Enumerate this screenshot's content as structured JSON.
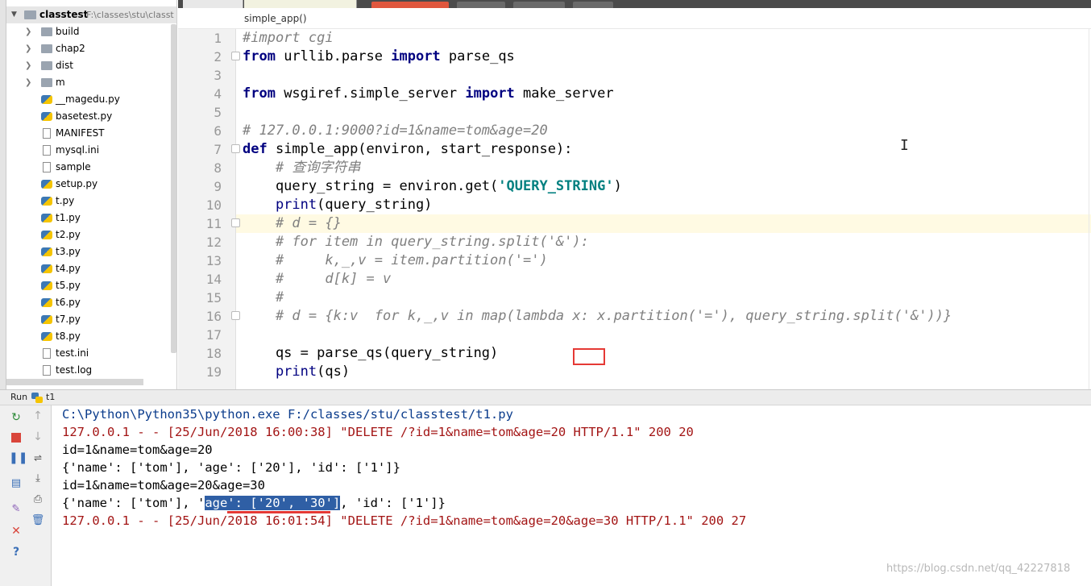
{
  "project": {
    "root_name": "classtest",
    "root_path": "F:\\classes\\stu\\classt",
    "folders": [
      "build",
      "chap2",
      "dist",
      "m"
    ],
    "files": [
      {
        "name": "__magedu.py",
        "type": "py"
      },
      {
        "name": "basetest.py",
        "type": "py"
      },
      {
        "name": "MANIFEST",
        "type": "file"
      },
      {
        "name": "mysql.ini",
        "type": "file"
      },
      {
        "name": "sample",
        "type": "file"
      },
      {
        "name": "setup.py",
        "type": "py"
      },
      {
        "name": "t.py",
        "type": "py"
      },
      {
        "name": "t1.py",
        "type": "py"
      },
      {
        "name": "t2.py",
        "type": "py"
      },
      {
        "name": "t3.py",
        "type": "py"
      },
      {
        "name": "t4.py",
        "type": "py"
      },
      {
        "name": "t5.py",
        "type": "py"
      },
      {
        "name": "t6.py",
        "type": "py"
      },
      {
        "name": "t7.py",
        "type": "py"
      },
      {
        "name": "t8.py",
        "type": "py"
      },
      {
        "name": "test.ini",
        "type": "file"
      },
      {
        "name": "test.log",
        "type": "file"
      }
    ]
  },
  "breadcrumb": "simple_app()",
  "editor": {
    "line_numbers": [
      "1",
      "2",
      "3",
      "4",
      "5",
      "6",
      "7",
      "8",
      "9",
      "10",
      "11",
      "12",
      "13",
      "14",
      "15",
      "16",
      "17",
      "18",
      "19"
    ],
    "current_line": "11",
    "code": {
      "l1": "#import cgi",
      "l2_kw": "from",
      "l2_mod": " urllib.parse ",
      "l2_kw2": "import",
      "l2_name": " parse_qs",
      "l4_kw": "from",
      "l4_mod": " wsgiref.simple_server ",
      "l4_kw2": "import",
      "l4_name": " make_server",
      "l6": "# 127.0.0.1:9000?id=1&name=tom&age=20",
      "l7_kw": "def",
      "l7_rest": " simple_app(environ, start_response):",
      "l8": "    # 查询字符串",
      "l9_a": "    query_string = environ.get(",
      "l9_str": "'QUERY_STRING'",
      "l9_b": ")",
      "l10_fn": "    print",
      "l10_rest": "(query_string)",
      "l11": "    # d = {}",
      "l12": "    # for item in query_string.split('&'):",
      "l13": "    #     k,_,v = item.partition('=')",
      "l14": "    #     d[k] = v",
      "l15": "    #",
      "l16": "    # d = {k:v  for k,_,v in map(lambda x: x.partition('='), query_string.split('&'))}",
      "l18": "    qs = parse_qs(query_string)",
      "l19_fn": "    print",
      "l19_rest": "(qs)"
    }
  },
  "run": {
    "label": "Run",
    "config": "t1",
    "lines": {
      "cmd": "C:\\Python\\Python35\\python.exe F:/classes/stu/classtest/t1.py",
      "log1": "127.0.0.1 - - [25/Jun/2018 16:00:38] \"DELETE /?id=1&name=tom&age=20 HTTP/1.1\" 200 20",
      "out1": "id=1&name=tom&age=20",
      "out2": "{'name': ['tom'], 'age': ['20'], 'id': ['1']}",
      "out3": "id=1&name=tom&age=20&age=30",
      "out4_a": "{'name': ['tom'], '",
      "out4_sel": "age': ['20', '30']",
      "out4_b": ", 'id': ['1']}",
      "log2": "127.0.0.1 - - [25/Jun/2018 16:01:54] \"DELETE /?id=1&name=tom&age=20&age=30 HTTP/1.1\" 200 27"
    },
    "watermark": "https://blog.csdn.net/qq_42227818"
  },
  "colors": {
    "accent_red": "#e53935",
    "selection": "#2f5fa5",
    "keyword": "#000080",
    "string": "#008080",
    "log_red": "#a31515"
  }
}
